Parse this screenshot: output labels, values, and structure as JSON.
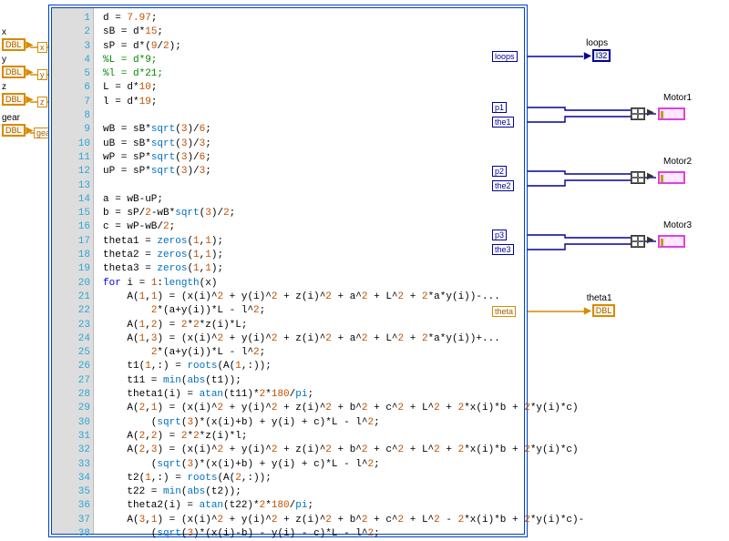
{
  "inputs": {
    "x": {
      "label": "x",
      "type": "DBL"
    },
    "y": {
      "label": "y",
      "type": "DBL"
    },
    "z": {
      "label": "z",
      "type": "DBL"
    },
    "gear": {
      "label": "gear",
      "type": "DBL"
    }
  },
  "tunnels": {
    "x": "x",
    "y": "y",
    "z": "z",
    "gear": "gear",
    "loops": "loops",
    "p1": "p1",
    "the1": "the1",
    "p2": "p2",
    "the2": "the2",
    "p3": "p3",
    "the3": "the3",
    "theta": "theta"
  },
  "outputs": {
    "loops": {
      "label": "loops",
      "type": "I32"
    },
    "motor1": {
      "label": "Motor1"
    },
    "motor2": {
      "label": "Motor2"
    },
    "motor3": {
      "label": "Motor3"
    },
    "theta1": {
      "label": "theta1",
      "type": "DBL"
    }
  },
  "code": [
    {
      "n": 1,
      "seg": [
        [
          "plain",
          "d = "
        ],
        [
          "num",
          "7.97"
        ],
        [
          "plain",
          ";"
        ]
      ]
    },
    {
      "n": 2,
      "seg": [
        [
          "plain",
          "sB = d*"
        ],
        [
          "num",
          "15"
        ],
        [
          "plain",
          ";"
        ]
      ]
    },
    {
      "n": 3,
      "seg": [
        [
          "plain",
          "sP = d*("
        ],
        [
          "num",
          "9"
        ],
        [
          "plain",
          "/"
        ],
        [
          "num",
          "2"
        ],
        [
          "plain",
          ");"
        ]
      ]
    },
    {
      "n": 4,
      "seg": [
        [
          "cmt",
          "%L = d*9;"
        ]
      ]
    },
    {
      "n": 5,
      "seg": [
        [
          "cmt",
          "%l = d*21;"
        ]
      ]
    },
    {
      "n": 6,
      "seg": [
        [
          "plain",
          "L = d*"
        ],
        [
          "num",
          "10"
        ],
        [
          "plain",
          ";"
        ]
      ]
    },
    {
      "n": 7,
      "seg": [
        [
          "plain",
          "l = d*"
        ],
        [
          "num",
          "19"
        ],
        [
          "plain",
          ";"
        ]
      ]
    },
    {
      "n": 8,
      "seg": []
    },
    {
      "n": 9,
      "seg": [
        [
          "plain",
          "wB = sB*"
        ],
        [
          "func",
          "sqrt"
        ],
        [
          "plain",
          "("
        ],
        [
          "num",
          "3"
        ],
        [
          "plain",
          ")/"
        ],
        [
          "num",
          "6"
        ],
        [
          "plain",
          ";"
        ]
      ]
    },
    {
      "n": 10,
      "seg": [
        [
          "plain",
          "uB = sB*"
        ],
        [
          "func",
          "sqrt"
        ],
        [
          "plain",
          "("
        ],
        [
          "num",
          "3"
        ],
        [
          "plain",
          ")/"
        ],
        [
          "num",
          "3"
        ],
        [
          "plain",
          ";"
        ]
      ]
    },
    {
      "n": 11,
      "seg": [
        [
          "plain",
          "wP = sP*"
        ],
        [
          "func",
          "sqrt"
        ],
        [
          "plain",
          "("
        ],
        [
          "num",
          "3"
        ],
        [
          "plain",
          ")/"
        ],
        [
          "num",
          "6"
        ],
        [
          "plain",
          ";"
        ]
      ]
    },
    {
      "n": 12,
      "seg": [
        [
          "plain",
          "uP = sP*"
        ],
        [
          "func",
          "sqrt"
        ],
        [
          "plain",
          "("
        ],
        [
          "num",
          "3"
        ],
        [
          "plain",
          ")/"
        ],
        [
          "num",
          "3"
        ],
        [
          "plain",
          ";"
        ]
      ]
    },
    {
      "n": 13,
      "seg": []
    },
    {
      "n": 14,
      "seg": [
        [
          "plain",
          "a = wB-uP;"
        ]
      ]
    },
    {
      "n": 15,
      "seg": [
        [
          "plain",
          "b = sP/"
        ],
        [
          "num",
          "2"
        ],
        [
          "plain",
          "-wB*"
        ],
        [
          "func",
          "sqrt"
        ],
        [
          "plain",
          "("
        ],
        [
          "num",
          "3"
        ],
        [
          "plain",
          ")/"
        ],
        [
          "num",
          "2"
        ],
        [
          "plain",
          ";"
        ]
      ]
    },
    {
      "n": 16,
      "seg": [
        [
          "plain",
          "c = wP-wB/"
        ],
        [
          "num",
          "2"
        ],
        [
          "plain",
          ";"
        ]
      ]
    },
    {
      "n": 17,
      "seg": [
        [
          "plain",
          "theta1 = "
        ],
        [
          "func",
          "zeros"
        ],
        [
          "plain",
          "("
        ],
        [
          "num",
          "1"
        ],
        [
          "plain",
          ","
        ],
        [
          "num",
          "1"
        ],
        [
          "plain",
          ");"
        ]
      ]
    },
    {
      "n": 18,
      "seg": [
        [
          "plain",
          "theta2 = "
        ],
        [
          "func",
          "zeros"
        ],
        [
          "plain",
          "("
        ],
        [
          "num",
          "1"
        ],
        [
          "plain",
          ","
        ],
        [
          "num",
          "1"
        ],
        [
          "plain",
          ");"
        ]
      ]
    },
    {
      "n": 19,
      "seg": [
        [
          "plain",
          "theta3 = "
        ],
        [
          "func",
          "zeros"
        ],
        [
          "plain",
          "("
        ],
        [
          "num",
          "1"
        ],
        [
          "plain",
          ","
        ],
        [
          "num",
          "1"
        ],
        [
          "plain",
          ");"
        ]
      ]
    },
    {
      "n": 20,
      "seg": [
        [
          "kw",
          "for "
        ],
        [
          "plain",
          "i = "
        ],
        [
          "num",
          "1"
        ],
        [
          "plain",
          ":"
        ],
        [
          "func",
          "length"
        ],
        [
          "plain",
          "(x)"
        ]
      ]
    },
    {
      "n": 21,
      "seg": [
        [
          "plain",
          "    A("
        ],
        [
          "num",
          "1"
        ],
        [
          "plain",
          ","
        ],
        [
          "num",
          "1"
        ],
        [
          "plain",
          ") = (x(i)^"
        ],
        [
          "num",
          "2"
        ],
        [
          "plain",
          " + y(i)^"
        ],
        [
          "num",
          "2"
        ],
        [
          "plain",
          " + z(i)^"
        ],
        [
          "num",
          "2"
        ],
        [
          "plain",
          " + a^"
        ],
        [
          "num",
          "2"
        ],
        [
          "plain",
          " + L^"
        ],
        [
          "num",
          "2"
        ],
        [
          "plain",
          " + "
        ],
        [
          "num",
          "2"
        ],
        [
          "plain",
          "*a*y(i))-..."
        ]
      ]
    },
    {
      "n": 22,
      "seg": [
        [
          "plain",
          "        "
        ],
        [
          "num",
          "2"
        ],
        [
          "plain",
          "*(a+y(i))*L - l^"
        ],
        [
          "num",
          "2"
        ],
        [
          "plain",
          ";"
        ]
      ]
    },
    {
      "n": 23,
      "seg": [
        [
          "plain",
          "    A("
        ],
        [
          "num",
          "1"
        ],
        [
          "plain",
          ","
        ],
        [
          "num",
          "2"
        ],
        [
          "plain",
          ") = "
        ],
        [
          "num",
          "2"
        ],
        [
          "plain",
          "*"
        ],
        [
          "num",
          "2"
        ],
        [
          "plain",
          "*z(i)*L;"
        ]
      ]
    },
    {
      "n": 24,
      "seg": [
        [
          "plain",
          "    A("
        ],
        [
          "num",
          "1"
        ],
        [
          "plain",
          ","
        ],
        [
          "num",
          "3"
        ],
        [
          "plain",
          ") = (x(i)^"
        ],
        [
          "num",
          "2"
        ],
        [
          "plain",
          " + y(i)^"
        ],
        [
          "num",
          "2"
        ],
        [
          "plain",
          " + z(i)^"
        ],
        [
          "num",
          "2"
        ],
        [
          "plain",
          " + a^"
        ],
        [
          "num",
          "2"
        ],
        [
          "plain",
          " + L^"
        ],
        [
          "num",
          "2"
        ],
        [
          "plain",
          " + "
        ],
        [
          "num",
          "2"
        ],
        [
          "plain",
          "*a*y(i))+..."
        ]
      ]
    },
    {
      "n": 25,
      "seg": [
        [
          "plain",
          "        "
        ],
        [
          "num",
          "2"
        ],
        [
          "plain",
          "*(a+y(i))*L - l^"
        ],
        [
          "num",
          "2"
        ],
        [
          "plain",
          ";"
        ]
      ]
    },
    {
      "n": 26,
      "seg": [
        [
          "plain",
          "    t1("
        ],
        [
          "num",
          "1"
        ],
        [
          "plain",
          ",:) = "
        ],
        [
          "func",
          "roots"
        ],
        [
          "plain",
          "(A("
        ],
        [
          "num",
          "1"
        ],
        [
          "plain",
          ",:));"
        ]
      ]
    },
    {
      "n": 27,
      "seg": [
        [
          "plain",
          "    t11 = "
        ],
        [
          "func",
          "min"
        ],
        [
          "plain",
          "("
        ],
        [
          "func",
          "abs"
        ],
        [
          "plain",
          "(t1));"
        ]
      ]
    },
    {
      "n": 28,
      "seg": [
        [
          "plain",
          "    theta1(i) = "
        ],
        [
          "func",
          "atan"
        ],
        [
          "plain",
          "(t11)*"
        ],
        [
          "num",
          "2"
        ],
        [
          "plain",
          "*"
        ],
        [
          "num",
          "180"
        ],
        [
          "plain",
          "/"
        ],
        [
          "func",
          "pi"
        ],
        [
          "plain",
          ";"
        ]
      ]
    },
    {
      "n": 29,
      "seg": [
        [
          "plain",
          "    A("
        ],
        [
          "num",
          "2"
        ],
        [
          "plain",
          ","
        ],
        [
          "num",
          "1"
        ],
        [
          "plain",
          ") = (x(i)^"
        ],
        [
          "num",
          "2"
        ],
        [
          "plain",
          " + y(i)^"
        ],
        [
          "num",
          "2"
        ],
        [
          "plain",
          " + z(i)^"
        ],
        [
          "num",
          "2"
        ],
        [
          "plain",
          " + b^"
        ],
        [
          "num",
          "2"
        ],
        [
          "plain",
          " + c^"
        ],
        [
          "num",
          "2"
        ],
        [
          "plain",
          " + L^"
        ],
        [
          "num",
          "2"
        ],
        [
          "plain",
          " + "
        ],
        [
          "num",
          "2"
        ],
        [
          "plain",
          "*x(i)*b + "
        ],
        [
          "num",
          "2"
        ],
        [
          "plain",
          "*y(i)*c)"
        ]
      ]
    },
    {
      "n": 30,
      "seg": [
        [
          "plain",
          "        ("
        ],
        [
          "func",
          "sqrt"
        ],
        [
          "plain",
          "("
        ],
        [
          "num",
          "3"
        ],
        [
          "plain",
          ")*(x(i)+b) + y(i) + c)*L - l^"
        ],
        [
          "num",
          "2"
        ],
        [
          "plain",
          ";"
        ]
      ]
    },
    {
      "n": 31,
      "seg": [
        [
          "plain",
          "    A("
        ],
        [
          "num",
          "2"
        ],
        [
          "plain",
          ","
        ],
        [
          "num",
          "2"
        ],
        [
          "plain",
          ") = "
        ],
        [
          "num",
          "2"
        ],
        [
          "plain",
          "*"
        ],
        [
          "num",
          "2"
        ],
        [
          "plain",
          "*z(i)*l;"
        ]
      ]
    },
    {
      "n": 32,
      "seg": [
        [
          "plain",
          "    A("
        ],
        [
          "num",
          "2"
        ],
        [
          "plain",
          ","
        ],
        [
          "num",
          "3"
        ],
        [
          "plain",
          ") = (x(i)^"
        ],
        [
          "num",
          "2"
        ],
        [
          "plain",
          " + y(i)^"
        ],
        [
          "num",
          "2"
        ],
        [
          "plain",
          " + z(i)^"
        ],
        [
          "num",
          "2"
        ],
        [
          "plain",
          " + b^"
        ],
        [
          "num",
          "2"
        ],
        [
          "plain",
          " + c^"
        ],
        [
          "num",
          "2"
        ],
        [
          "plain",
          " + L^"
        ],
        [
          "num",
          "2"
        ],
        [
          "plain",
          " + "
        ],
        [
          "num",
          "2"
        ],
        [
          "plain",
          "*x(i)*b + "
        ],
        [
          "num",
          "2"
        ],
        [
          "plain",
          "*y(i)*c)"
        ]
      ]
    },
    {
      "n": 33,
      "seg": [
        [
          "plain",
          "        ("
        ],
        [
          "func",
          "sqrt"
        ],
        [
          "plain",
          "("
        ],
        [
          "num",
          "3"
        ],
        [
          "plain",
          ")*(x(i)+b) + y(i) + c)*L - l^"
        ],
        [
          "num",
          "2"
        ],
        [
          "plain",
          ";"
        ]
      ]
    },
    {
      "n": 34,
      "seg": [
        [
          "plain",
          "    t2("
        ],
        [
          "num",
          "1"
        ],
        [
          "plain",
          ",:) = "
        ],
        [
          "func",
          "roots"
        ],
        [
          "plain",
          "(A("
        ],
        [
          "num",
          "2"
        ],
        [
          "plain",
          ",:));"
        ]
      ]
    },
    {
      "n": 35,
      "seg": [
        [
          "plain",
          "    t22 = "
        ],
        [
          "func",
          "min"
        ],
        [
          "plain",
          "("
        ],
        [
          "func",
          "abs"
        ],
        [
          "plain",
          "(t2));"
        ]
      ]
    },
    {
      "n": 36,
      "seg": [
        [
          "plain",
          "    theta2(i) = "
        ],
        [
          "func",
          "atan"
        ],
        [
          "plain",
          "(t22)*"
        ],
        [
          "num",
          "2"
        ],
        [
          "plain",
          "*"
        ],
        [
          "num",
          "180"
        ],
        [
          "plain",
          "/"
        ],
        [
          "func",
          "pi"
        ],
        [
          "plain",
          ";"
        ]
      ]
    },
    {
      "n": 37,
      "seg": [
        [
          "plain",
          "    A("
        ],
        [
          "num",
          "3"
        ],
        [
          "plain",
          ","
        ],
        [
          "num",
          "1"
        ],
        [
          "plain",
          ") = (x(i)^"
        ],
        [
          "num",
          "2"
        ],
        [
          "plain",
          " + y(i)^"
        ],
        [
          "num",
          "2"
        ],
        [
          "plain",
          " + z(i)^"
        ],
        [
          "num",
          "2"
        ],
        [
          "plain",
          " + b^"
        ],
        [
          "num",
          "2"
        ],
        [
          "plain",
          " + c^"
        ],
        [
          "num",
          "2"
        ],
        [
          "plain",
          " + L^"
        ],
        [
          "num",
          "2"
        ],
        [
          "plain",
          " - "
        ],
        [
          "num",
          "2"
        ],
        [
          "plain",
          "*x(i)*b + "
        ],
        [
          "num",
          "2"
        ],
        [
          "plain",
          "*y(i)*c)-"
        ]
      ]
    },
    {
      "n": 38,
      "seg": [
        [
          "plain",
          "        ("
        ],
        [
          "func",
          "sqrt"
        ],
        [
          "plain",
          "("
        ],
        [
          "num",
          "3"
        ],
        [
          "plain",
          ")*(x(i)-b) - y(i) - c)*L - l^"
        ],
        [
          "num",
          "2"
        ],
        [
          "plain",
          ";"
        ]
      ]
    }
  ]
}
